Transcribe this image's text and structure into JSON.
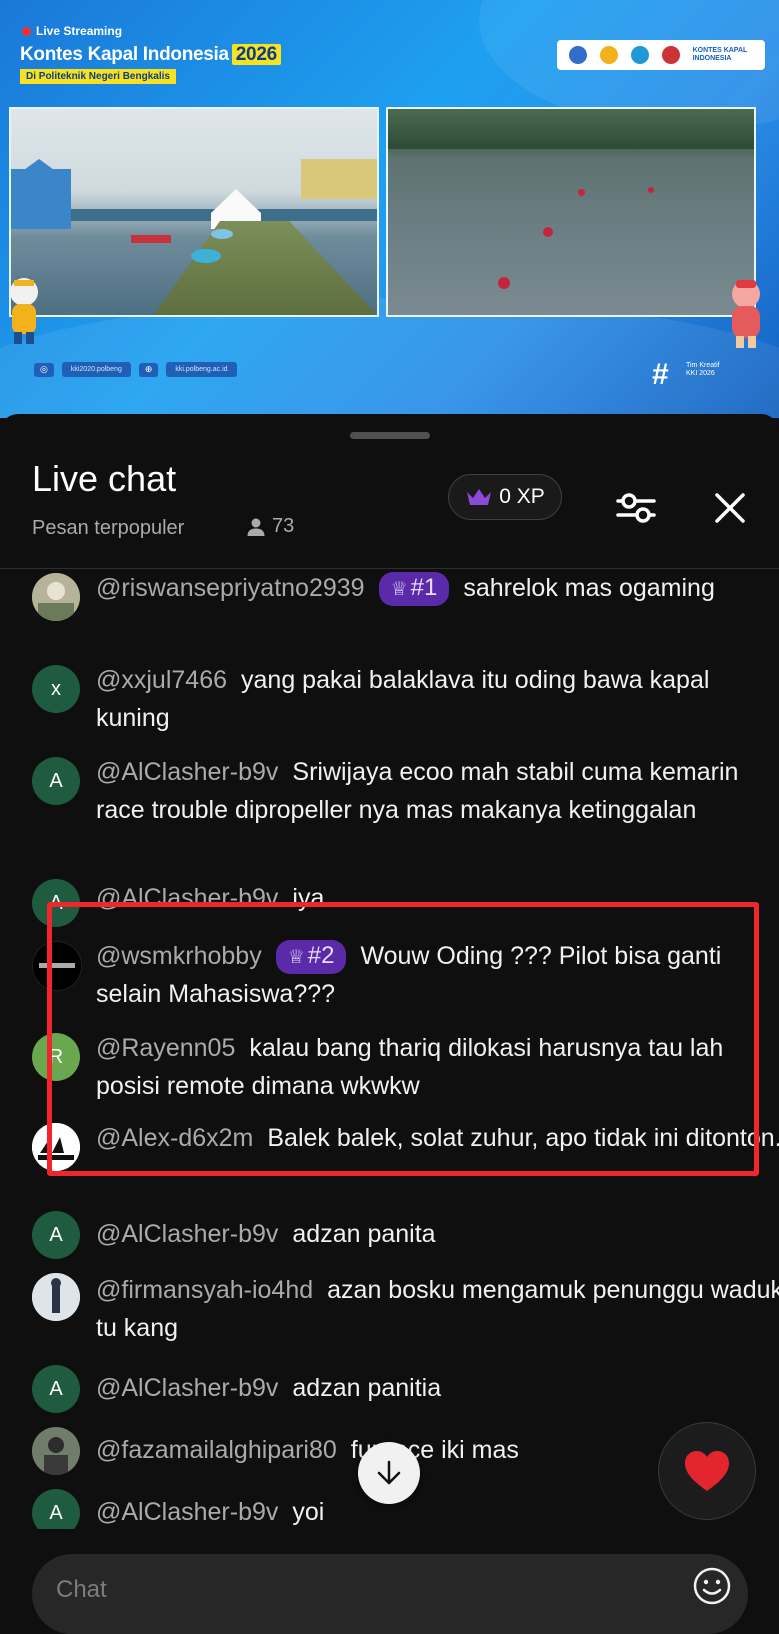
{
  "video": {
    "live_label": "Live Streaming",
    "title": "Kontes Kapal Indonesia",
    "year": "2026",
    "subtitle": "Di Politeknik Negeri Bengkalis",
    "logo_text": "KONTES KAPAL INDONESIA",
    "social_handle": "kki2020.polbeng",
    "website": "kki.polbeng.ac.id",
    "hashtag_text": "Tim Kreatif KKI 2026"
  },
  "chat": {
    "title": "Live chat",
    "filter_label": "Pesan terpopuler",
    "viewer_count": "73",
    "xp_label": "0 XP",
    "input_placeholder": "Chat",
    "messages": [
      {
        "author": "@riswansepriyatno2939",
        "badge": "#1",
        "text": "sahrelok mas ogaming",
        "avatar_letter": "",
        "avatar_color": "#8a8f7a"
      },
      {
        "author": "@xxjul7466",
        "badge": "",
        "text": "yang pakai balaklava itu oding bawa kapal kuning",
        "avatar_letter": "x",
        "avatar_color": "#1f5c3f"
      },
      {
        "author": "@AlClasher-b9v",
        "badge": "",
        "text": "Sriwijaya ecoo mah stabil cuma kemarin race trouble dipropeller nya mas makanya ketinggalan",
        "avatar_letter": "A",
        "avatar_color": "#1f5c3f"
      },
      {
        "author": "@AlClasher-b9v",
        "badge": "",
        "text": "iya",
        "avatar_letter": "A",
        "avatar_color": "#1f5c3f"
      },
      {
        "author": "@wsmkrhobby",
        "badge": "#2",
        "text": "Wouw Oding ??? Pilot bisa ganti selain Mahasiswa???",
        "avatar_letter": "",
        "avatar_color": "#000000"
      },
      {
        "author": "@Rayenn05",
        "badge": "",
        "text": "kalau bang thariq dilokasi harusnya tau lah posisi remote dimana wkwkw",
        "avatar_letter": "R",
        "avatar_color": "#6aa84f"
      },
      {
        "author": "@Alex-d6x2m",
        "badge": "",
        "text": "Balek balek, solat zuhur, apo tidak ini ditonton.",
        "avatar_letter": "",
        "avatar_color": "#ffffff"
      },
      {
        "author": "@AlClasher-b9v",
        "badge": "",
        "text": "adzan panita",
        "avatar_letter": "A",
        "avatar_color": "#1f5c3f"
      },
      {
        "author": "@firmansyah-io4hd",
        "badge": "",
        "text": "azan bosku mengamuk penunggu waduk tu kang",
        "avatar_letter": "",
        "avatar_color": "#c9d4dc"
      },
      {
        "author": "@AlClasher-b9v",
        "badge": "",
        "text": "adzan panitia",
        "avatar_letter": "A",
        "avatar_color": "#1f5c3f"
      },
      {
        "author": "@fazamailalghipari80",
        "badge": "",
        "text": "funrace iki mas",
        "avatar_letter": "",
        "avatar_color": "#4d5a4a"
      },
      {
        "author": "@AlClasher-b9v",
        "badge": "",
        "text": "yoi",
        "avatar_letter": "A",
        "avatar_color": "#1f5c3f"
      }
    ]
  },
  "colors": {
    "badge_bg": "#5b2aa8",
    "highlight_border": "#f0262c",
    "banner_blue": "#1ea0f0"
  },
  "icons": [
    "live-dot-icon",
    "crown-icon",
    "person-icon",
    "sliders-icon",
    "close-icon",
    "arrow-down-icon",
    "heart-icon",
    "emoji-icon",
    "instagram-icon",
    "tiktok-icon",
    "globe-icon"
  ]
}
